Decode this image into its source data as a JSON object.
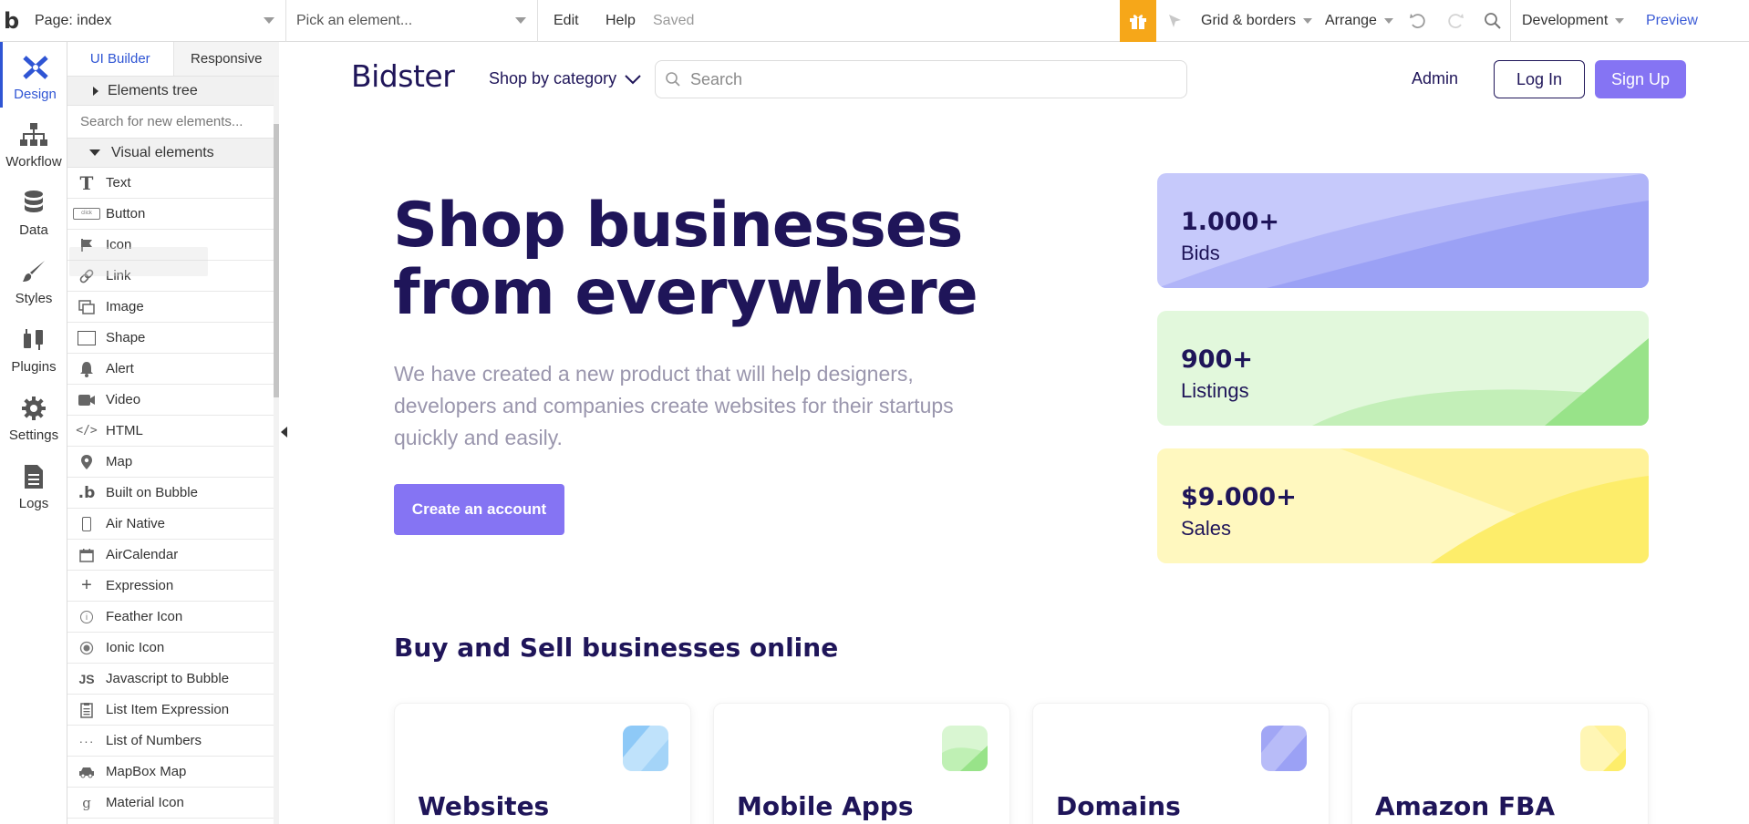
{
  "topbar": {
    "logo": "b",
    "page_select": "Page: index",
    "element_select": "Pick an element...",
    "edit": "Edit",
    "help": "Help",
    "saved": "Saved",
    "grid_borders": "Grid & borders",
    "arrange": "Arrange",
    "environment": "Development",
    "preview": "Preview"
  },
  "rail": {
    "items": [
      {
        "label": "Design"
      },
      {
        "label": "Workflow"
      },
      {
        "label": "Data"
      },
      {
        "label": "Styles"
      },
      {
        "label": "Plugins"
      },
      {
        "label": "Settings"
      },
      {
        "label": "Logs"
      }
    ]
  },
  "panel": {
    "tab_ui_builder": "UI Builder",
    "tab_responsive": "Responsive",
    "elements_tree": "Elements tree",
    "search_placeholder": "Search for new elements...",
    "visual_elements": "Visual elements",
    "elements": [
      {
        "label": "Text",
        "icon": "text-icon"
      },
      {
        "label": "Button",
        "icon": "button-icon"
      },
      {
        "label": "Icon",
        "icon": "flag-icon"
      },
      {
        "label": "Link",
        "icon": "link-icon"
      },
      {
        "label": "Image",
        "icon": "image-icon"
      },
      {
        "label": "Shape",
        "icon": "shape-icon"
      },
      {
        "label": "Alert",
        "icon": "bell-icon"
      },
      {
        "label": "Video",
        "icon": "video-icon"
      },
      {
        "label": "HTML",
        "icon": "code-icon"
      },
      {
        "label": "Map",
        "icon": "map-pin-icon"
      },
      {
        "label": "Built on Bubble",
        "icon": "bubble-logo-icon"
      },
      {
        "label": "Air Native",
        "icon": "phone-icon"
      },
      {
        "label": "AirCalendar",
        "icon": "calendar-icon"
      },
      {
        "label": "Expression",
        "icon": "plus-icon"
      },
      {
        "label": "Feather Icon",
        "icon": "info-circle-icon"
      },
      {
        "label": "Ionic Icon",
        "icon": "radio-circle-icon"
      },
      {
        "label": "Javascript to Bubble",
        "icon": "js-icon"
      },
      {
        "label": "List Item Expression",
        "icon": "clipboard-icon"
      },
      {
        "label": "List of Numbers",
        "icon": "dots-icon"
      },
      {
        "label": "MapBox Map",
        "icon": "car-icon"
      },
      {
        "label": "Material Icon",
        "icon": "material-g-icon"
      }
    ]
  },
  "site": {
    "brand": "Bidster",
    "category_menu": "Shop by category",
    "search_placeholder": "Search",
    "admin": "Admin",
    "login": "Log In",
    "signup": "Sign Up",
    "hero_line1": "Shop businesses",
    "hero_line2": "from everywhere",
    "hero_sub": "We have created a new product that will help designers, developers and companies create websites for their startups quickly and easily.",
    "cta": "Create an account",
    "stats": [
      {
        "value": "1.000+",
        "label": "Bids",
        "color": "#a5a9f7"
      },
      {
        "value": "900+",
        "label": "Listings",
        "color": "#bff0b4"
      },
      {
        "value": "$9.000+",
        "label": "Sales",
        "color": "#fff29a"
      }
    ],
    "section_title": "Buy and Sell businesses online",
    "cards": [
      {
        "title": "Websites",
        "color": "#8ec9f7"
      },
      {
        "title": "Mobile Apps",
        "color": "#a8e89c"
      },
      {
        "title": "Domains",
        "color": "#a1a6f5"
      },
      {
        "title": "Amazon FBA",
        "color": "#fdef8a"
      }
    ]
  },
  "colors": {
    "accent": "#8574f3",
    "brand_dark": "#1f1559",
    "editor_blue": "#2f55d4",
    "gift": "#f6a719"
  }
}
